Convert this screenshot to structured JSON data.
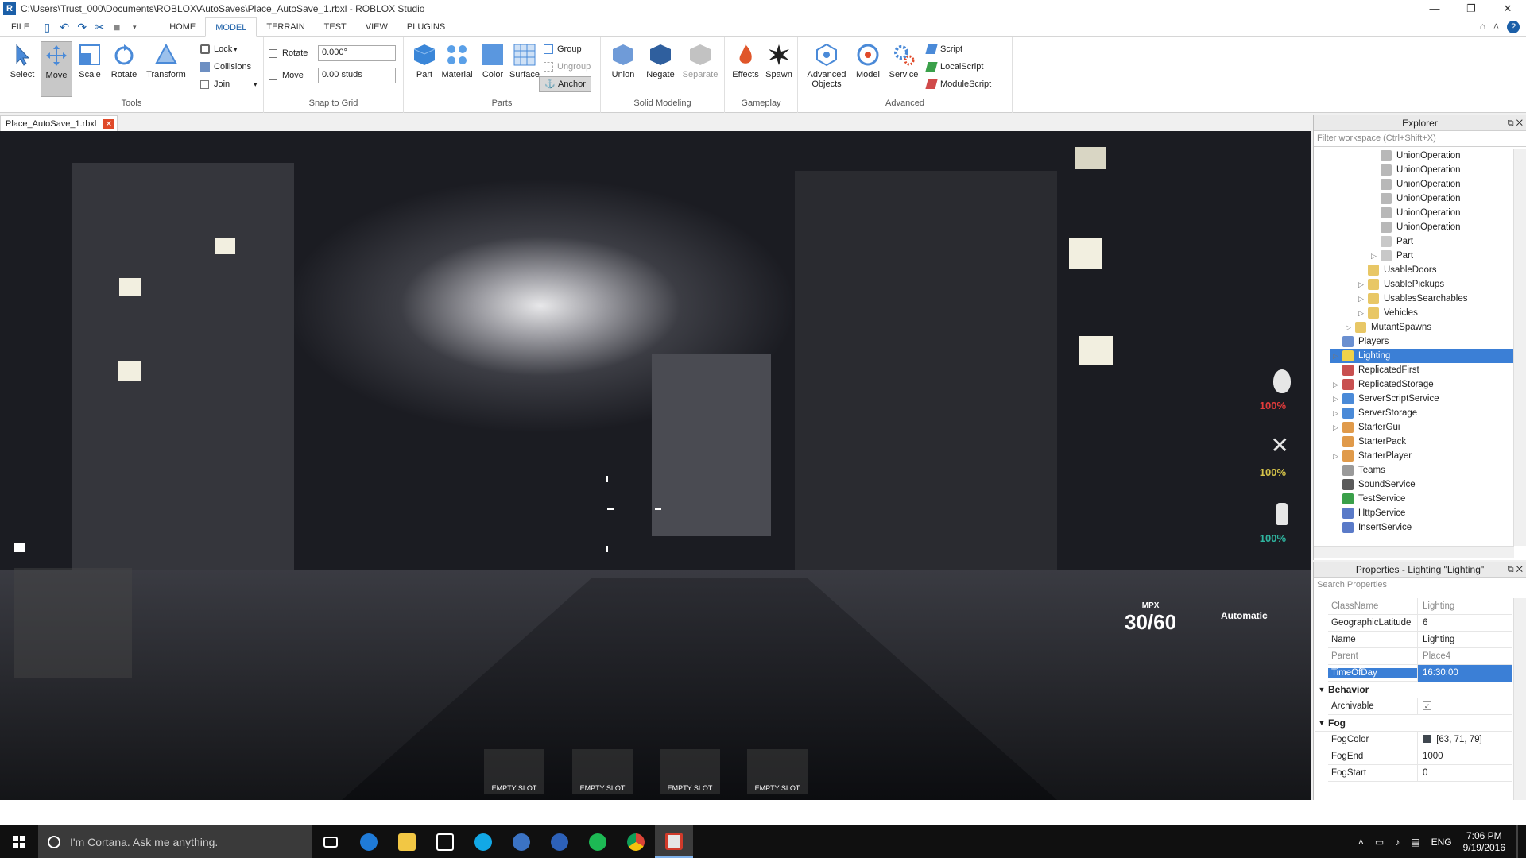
{
  "window": {
    "title": "C:\\Users\\Trust_000\\Documents\\ROBLOX\\AutoSaves\\Place_AutoSave_1.rbxl - ROBLOX Studio",
    "controls": {
      "minimize": "—",
      "maximize": "❐",
      "close": "✕"
    }
  },
  "menu": {
    "file": "FILE",
    "tabs": [
      "HOME",
      "MODEL",
      "TERRAIN",
      "TEST",
      "VIEW",
      "PLUGINS"
    ],
    "active_tab": "MODEL",
    "help": "?"
  },
  "ribbon": {
    "tools": {
      "label": "Tools",
      "buttons": [
        "Select",
        "Move",
        "Scale",
        "Rotate",
        "Transform"
      ],
      "active": "Move",
      "small": {
        "lock": "Lock",
        "collisions": "Collisions",
        "join": "Join"
      }
    },
    "snap": {
      "label": "Snap to Grid",
      "rotate_label": "Rotate",
      "rotate_value": "0.000°",
      "move_label": "Move",
      "move_value": "0.00 studs"
    },
    "parts": {
      "label": "Parts",
      "buttons": [
        "Part",
        "Material",
        "Color",
        "Surface"
      ],
      "group": "Group",
      "ungroup": "Ungroup",
      "anchor": "Anchor"
    },
    "solid": {
      "label": "Solid Modeling",
      "buttons": [
        "Union",
        "Negate",
        "Separate"
      ]
    },
    "gameplay": {
      "label": "Gameplay",
      "buttons": [
        "Effects",
        "Spawn"
      ]
    },
    "advanced": {
      "label": "Advanced",
      "adv_objects": "Advanced Objects",
      "model": "Model",
      "service": "Service",
      "scripts": [
        "Script",
        "LocalScript",
        "ModuleScript"
      ]
    }
  },
  "document": {
    "tab": "Place_AutoSave_1.rbxl"
  },
  "game_hud": {
    "health_pct": "100%",
    "stamina_pct": "100%",
    "third_pct": "100%",
    "slots": [
      "EMPTY SLOT",
      "EMPTY SLOT",
      "EMPTY SLOT",
      "EMPTY SLOT"
    ],
    "ammo_label": "MPX",
    "ammo_value": "30/60",
    "fire_mode": "Automatic",
    "colors": {
      "health": "#e23b3b",
      "stamina": "#d6c44a",
      "third": "#2fb5a0"
    }
  },
  "explorer": {
    "title": "Explorer",
    "filter_placeholder": "Filter workspace (Ctrl+Shift+X)",
    "items": [
      "UnionOperation",
      "UnionOperation",
      "UnionOperation",
      "UnionOperation",
      "UnionOperation",
      "UnionOperation",
      "Part",
      "Part",
      "UsableDoors",
      "UsablePickups",
      "UsablesSearchables",
      "Vehicles",
      "MutantSpawns",
      "Players",
      "Lighting",
      "ReplicatedFirst",
      "ReplicatedStorage",
      "ServerScriptService",
      "ServerStorage",
      "StarterGui",
      "StarterPack",
      "StarterPlayer",
      "Teams",
      "SoundService",
      "TestService",
      "HttpService",
      "InsertService"
    ],
    "selected": "Lighting"
  },
  "properties": {
    "title": "Properties - Lighting \"Lighting\"",
    "search_placeholder": "Search Properties",
    "rows": {
      "classname": {
        "name": "ClassName",
        "value": "Lighting"
      },
      "latitude": {
        "name": "GeographicLatitude",
        "value": "6"
      },
      "name": {
        "name": "Name",
        "value": "Lighting"
      },
      "parent": {
        "name": "Parent",
        "value": "Place4"
      },
      "timeofday": {
        "name": "TimeOfDay",
        "value": "16:30:00"
      },
      "archivable": {
        "name": "Archivable",
        "value": "✓"
      },
      "fogcolor": {
        "name": "FogColor",
        "value": "[63, 71, 79]",
        "swatch": "#3f474f"
      },
      "fogend": {
        "name": "FogEnd",
        "value": "1000"
      },
      "fogstart": {
        "name": "FogStart",
        "value": "0"
      }
    },
    "categories": {
      "behavior": "Behavior",
      "fog": "Fog"
    }
  },
  "taskbar": {
    "cortana": "I'm Cortana. Ask me anything.",
    "lang": "ENG",
    "time": "7:06 PM",
    "date": "9/19/2016"
  }
}
